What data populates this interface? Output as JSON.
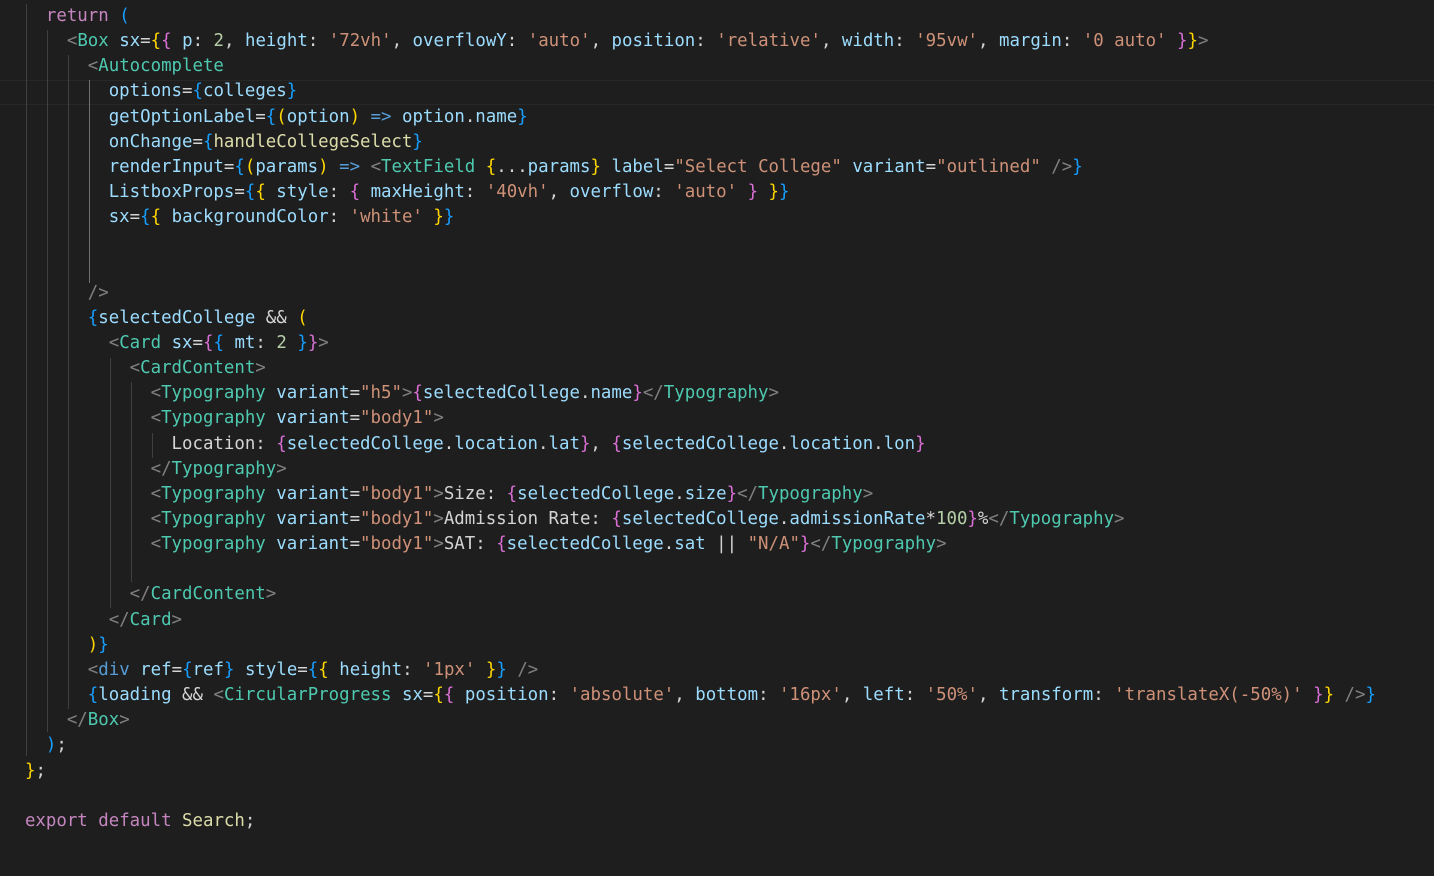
{
  "editor": {
    "language": "javascript-react",
    "theme": "dark",
    "lines": [
      [
        [
          "    ",
          "txt"
        ],
        [
          "return",
          "kw"
        ],
        [
          " ",
          "txt"
        ],
        [
          "(",
          "b3"
        ]
      ],
      [
        [
          "      ",
          "txt"
        ],
        [
          "<",
          "tb"
        ],
        [
          "Box",
          "tag"
        ],
        [
          " ",
          "txt"
        ],
        [
          "sx",
          "attr"
        ],
        [
          "=",
          "txt"
        ],
        [
          "{",
          "b1"
        ],
        [
          "{",
          "b2"
        ],
        [
          " ",
          "txt"
        ],
        [
          "p",
          "attr"
        ],
        [
          ": ",
          "txt"
        ],
        [
          "2",
          "num"
        ],
        [
          ", ",
          "txt"
        ],
        [
          "height",
          "attr"
        ],
        [
          ": ",
          "txt"
        ],
        [
          "'72vh'",
          "str"
        ],
        [
          ", ",
          "txt"
        ],
        [
          "overflowY",
          "attr"
        ],
        [
          ": ",
          "txt"
        ],
        [
          "'auto'",
          "str"
        ],
        [
          ", ",
          "txt"
        ],
        [
          "position",
          "attr"
        ],
        [
          ": ",
          "txt"
        ],
        [
          "'relative'",
          "str"
        ],
        [
          ", ",
          "txt"
        ],
        [
          "width",
          "attr"
        ],
        [
          ": ",
          "txt"
        ],
        [
          "'95vw'",
          "str"
        ],
        [
          ", ",
          "txt"
        ],
        [
          "margin",
          "attr"
        ],
        [
          ": ",
          "txt"
        ],
        [
          "'0 auto'",
          "str"
        ],
        [
          " ",
          "txt"
        ],
        [
          "}",
          "b2"
        ],
        [
          "}",
          "b1"
        ],
        [
          ">",
          "tb"
        ]
      ],
      [
        [
          "        ",
          "txt"
        ],
        [
          "<",
          "tb"
        ],
        [
          "Autocomplete",
          "tag"
        ]
      ],
      [
        [
          "          ",
          "txt"
        ],
        [
          "options",
          "attr"
        ],
        [
          "=",
          "txt"
        ],
        [
          "{",
          "b3"
        ],
        [
          "colleges",
          "var"
        ],
        [
          "}",
          "b3"
        ]
      ],
      [
        [
          "          ",
          "txt"
        ],
        [
          "getOptionLabel",
          "attr"
        ],
        [
          "=",
          "txt"
        ],
        [
          "{",
          "b3"
        ],
        [
          "(",
          "b1"
        ],
        [
          "option",
          "var"
        ],
        [
          ")",
          "b1"
        ],
        [
          " ",
          "txt"
        ],
        [
          "=>",
          "kb"
        ],
        [
          " ",
          "txt"
        ],
        [
          "option",
          "var"
        ],
        [
          ".",
          "txt"
        ],
        [
          "name",
          "var"
        ],
        [
          "}",
          "b3"
        ]
      ],
      [
        [
          "          ",
          "txt"
        ],
        [
          "onChange",
          "attr"
        ],
        [
          "=",
          "txt"
        ],
        [
          "{",
          "b3"
        ],
        [
          "handleCollegeSelect",
          "fn"
        ],
        [
          "}",
          "b3"
        ]
      ],
      [
        [
          "          ",
          "txt"
        ],
        [
          "renderInput",
          "attr"
        ],
        [
          "=",
          "txt"
        ],
        [
          "{",
          "b3"
        ],
        [
          "(",
          "b1"
        ],
        [
          "params",
          "var"
        ],
        [
          ")",
          "b1"
        ],
        [
          " ",
          "txt"
        ],
        [
          "=>",
          "kb"
        ],
        [
          " ",
          "txt"
        ],
        [
          "<",
          "tb"
        ],
        [
          "TextField",
          "tag"
        ],
        [
          " ",
          "txt"
        ],
        [
          "{",
          "b1"
        ],
        [
          "...",
          "txt"
        ],
        [
          "params",
          "var"
        ],
        [
          "}",
          "b1"
        ],
        [
          " ",
          "txt"
        ],
        [
          "label",
          "attr"
        ],
        [
          "=",
          "txt"
        ],
        [
          "\"Select College\"",
          "str"
        ],
        [
          " ",
          "txt"
        ],
        [
          "variant",
          "attr"
        ],
        [
          "=",
          "txt"
        ],
        [
          "\"outlined\"",
          "str"
        ],
        [
          " ",
          "txt"
        ],
        [
          "/>",
          "tb"
        ],
        [
          "}",
          "b3"
        ]
      ],
      [
        [
          "          ",
          "txt"
        ],
        [
          "ListboxProps",
          "attr"
        ],
        [
          "=",
          "txt"
        ],
        [
          "{",
          "b3"
        ],
        [
          "{",
          "b1"
        ],
        [
          " ",
          "txt"
        ],
        [
          "style",
          "attr"
        ],
        [
          ": ",
          "txt"
        ],
        [
          "{",
          "b2"
        ],
        [
          " ",
          "txt"
        ],
        [
          "maxHeight",
          "attr"
        ],
        [
          ": ",
          "txt"
        ],
        [
          "'40vh'",
          "str"
        ],
        [
          ", ",
          "txt"
        ],
        [
          "overflow",
          "attr"
        ],
        [
          ": ",
          "txt"
        ],
        [
          "'auto'",
          "str"
        ],
        [
          " ",
          "txt"
        ],
        [
          "}",
          "b2"
        ],
        [
          " ",
          "txt"
        ],
        [
          "}",
          "b1"
        ],
        [
          "}",
          "b3"
        ]
      ],
      [
        [
          "          ",
          "txt"
        ],
        [
          "sx",
          "attr"
        ],
        [
          "=",
          "txt"
        ],
        [
          "{",
          "b3"
        ],
        [
          "{",
          "b1"
        ],
        [
          " ",
          "txt"
        ],
        [
          "backgroundColor",
          "attr"
        ],
        [
          ": ",
          "txt"
        ],
        [
          "'white'",
          "str"
        ],
        [
          " ",
          "txt"
        ],
        [
          "}",
          "b1"
        ],
        [
          "}",
          "b3"
        ]
      ],
      [],
      [],
      [
        [
          "        ",
          "txt"
        ],
        [
          "/>",
          "tb"
        ]
      ],
      [
        [
          "        ",
          "txt"
        ],
        [
          "{",
          "b3"
        ],
        [
          "selectedCollege",
          "var"
        ],
        [
          " ",
          "txt"
        ],
        [
          "&&",
          "txt"
        ],
        [
          " ",
          "txt"
        ],
        [
          "(",
          "b1"
        ]
      ],
      [
        [
          "          ",
          "txt"
        ],
        [
          "<",
          "tb"
        ],
        [
          "Card",
          "tag"
        ],
        [
          " ",
          "txt"
        ],
        [
          "sx",
          "attr"
        ],
        [
          "=",
          "txt"
        ],
        [
          "{",
          "b2"
        ],
        [
          "{",
          "b3"
        ],
        [
          " ",
          "txt"
        ],
        [
          "mt",
          "attr"
        ],
        [
          ": ",
          "txt"
        ],
        [
          "2",
          "num"
        ],
        [
          " ",
          "txt"
        ],
        [
          "}",
          "b3"
        ],
        [
          "}",
          "b2"
        ],
        [
          ">",
          "tb"
        ]
      ],
      [
        [
          "            ",
          "txt"
        ],
        [
          "<",
          "tb"
        ],
        [
          "CardContent",
          "tag"
        ],
        [
          ">",
          "tb"
        ]
      ],
      [
        [
          "              ",
          "txt"
        ],
        [
          "<",
          "tb"
        ],
        [
          "Typography",
          "tag"
        ],
        [
          " ",
          "txt"
        ],
        [
          "variant",
          "attr"
        ],
        [
          "=",
          "txt"
        ],
        [
          "\"h5\"",
          "str"
        ],
        [
          ">",
          "tb"
        ],
        [
          "{",
          "b2"
        ],
        [
          "selectedCollege",
          "var"
        ],
        [
          ".",
          "txt"
        ],
        [
          "name",
          "var"
        ],
        [
          "}",
          "b2"
        ],
        [
          "</",
          "tb"
        ],
        [
          "Typography",
          "tag"
        ],
        [
          ">",
          "tb"
        ]
      ],
      [
        [
          "              ",
          "txt"
        ],
        [
          "<",
          "tb"
        ],
        [
          "Typography",
          "tag"
        ],
        [
          " ",
          "txt"
        ],
        [
          "variant",
          "attr"
        ],
        [
          "=",
          "txt"
        ],
        [
          "\"body1\"",
          "str"
        ],
        [
          ">",
          "tb"
        ]
      ],
      [
        [
          "                ",
          "txt"
        ],
        [
          "Location: ",
          "txt"
        ],
        [
          "{",
          "b2"
        ],
        [
          "selectedCollege",
          "var"
        ],
        [
          ".",
          "txt"
        ],
        [
          "location",
          "var"
        ],
        [
          ".",
          "txt"
        ],
        [
          "lat",
          "var"
        ],
        [
          "}",
          "b2"
        ],
        [
          ", ",
          "txt"
        ],
        [
          "{",
          "b2"
        ],
        [
          "selectedCollege",
          "var"
        ],
        [
          ".",
          "txt"
        ],
        [
          "location",
          "var"
        ],
        [
          ".",
          "txt"
        ],
        [
          "lon",
          "var"
        ],
        [
          "}",
          "b2"
        ]
      ],
      [
        [
          "              ",
          "txt"
        ],
        [
          "</",
          "tb"
        ],
        [
          "Typography",
          "tag"
        ],
        [
          ">",
          "tb"
        ]
      ],
      [
        [
          "              ",
          "txt"
        ],
        [
          "<",
          "tb"
        ],
        [
          "Typography",
          "tag"
        ],
        [
          " ",
          "txt"
        ],
        [
          "variant",
          "attr"
        ],
        [
          "=",
          "txt"
        ],
        [
          "\"body1\"",
          "str"
        ],
        [
          ">",
          "tb"
        ],
        [
          "Size: ",
          "txt"
        ],
        [
          "{",
          "b2"
        ],
        [
          "selectedCollege",
          "var"
        ],
        [
          ".",
          "txt"
        ],
        [
          "size",
          "var"
        ],
        [
          "}",
          "b2"
        ],
        [
          "</",
          "tb"
        ],
        [
          "Typography",
          "tag"
        ],
        [
          ">",
          "tb"
        ]
      ],
      [
        [
          "              ",
          "txt"
        ],
        [
          "<",
          "tb"
        ],
        [
          "Typography",
          "tag"
        ],
        [
          " ",
          "txt"
        ],
        [
          "variant",
          "attr"
        ],
        [
          "=",
          "txt"
        ],
        [
          "\"body1\"",
          "str"
        ],
        [
          ">",
          "tb"
        ],
        [
          "Admission Rate: ",
          "txt"
        ],
        [
          "{",
          "b2"
        ],
        [
          "selectedCollege",
          "var"
        ],
        [
          ".",
          "txt"
        ],
        [
          "admissionRate",
          "var"
        ],
        [
          "*",
          "txt"
        ],
        [
          "100",
          "num"
        ],
        [
          "}",
          "b2"
        ],
        [
          "%",
          "txt"
        ],
        [
          "</",
          "tb"
        ],
        [
          "Typography",
          "tag"
        ],
        [
          ">",
          "tb"
        ]
      ],
      [
        [
          "              ",
          "txt"
        ],
        [
          "<",
          "tb"
        ],
        [
          "Typography",
          "tag"
        ],
        [
          " ",
          "txt"
        ],
        [
          "variant",
          "attr"
        ],
        [
          "=",
          "txt"
        ],
        [
          "\"body1\"",
          "str"
        ],
        [
          ">",
          "tb"
        ],
        [
          "SAT: ",
          "txt"
        ],
        [
          "{",
          "b2"
        ],
        [
          "selectedCollege",
          "var"
        ],
        [
          ".",
          "txt"
        ],
        [
          "sat",
          "var"
        ],
        [
          " ",
          "txt"
        ],
        [
          "||",
          "txt"
        ],
        [
          " ",
          "txt"
        ],
        [
          "\"N/A\"",
          "str"
        ],
        [
          "}",
          "b2"
        ],
        [
          "</",
          "tb"
        ],
        [
          "Typography",
          "tag"
        ],
        [
          ">",
          "tb"
        ]
      ],
      [],
      [
        [
          "            ",
          "txt"
        ],
        [
          "</",
          "tb"
        ],
        [
          "CardContent",
          "tag"
        ],
        [
          ">",
          "tb"
        ]
      ],
      [
        [
          "          ",
          "txt"
        ],
        [
          "</",
          "tb"
        ],
        [
          "Card",
          "tag"
        ],
        [
          ">",
          "tb"
        ]
      ],
      [
        [
          "        ",
          "txt"
        ],
        [
          ")",
          "b1"
        ],
        [
          "}",
          "b3"
        ]
      ],
      [
        [
          "        ",
          "txt"
        ],
        [
          "<",
          "tb"
        ],
        [
          "div",
          "kb"
        ],
        [
          " ",
          "txt"
        ],
        [
          "ref",
          "attr"
        ],
        [
          "=",
          "txt"
        ],
        [
          "{",
          "b3"
        ],
        [
          "ref",
          "var"
        ],
        [
          "}",
          "b3"
        ],
        [
          " ",
          "txt"
        ],
        [
          "style",
          "attr"
        ],
        [
          "=",
          "txt"
        ],
        [
          "{",
          "b3"
        ],
        [
          "{",
          "b1"
        ],
        [
          " ",
          "txt"
        ],
        [
          "height",
          "attr"
        ],
        [
          ": ",
          "txt"
        ],
        [
          "'1px'",
          "str"
        ],
        [
          " ",
          "txt"
        ],
        [
          "}",
          "b1"
        ],
        [
          "}",
          "b3"
        ],
        [
          " ",
          "txt"
        ],
        [
          "/>",
          "tb"
        ]
      ],
      [
        [
          "        ",
          "txt"
        ],
        [
          "{",
          "b3"
        ],
        [
          "loading",
          "var"
        ],
        [
          " ",
          "txt"
        ],
        [
          "&&",
          "txt"
        ],
        [
          " ",
          "txt"
        ],
        [
          "<",
          "tb"
        ],
        [
          "CircularProgress",
          "tag"
        ],
        [
          " ",
          "txt"
        ],
        [
          "sx",
          "attr"
        ],
        [
          "=",
          "txt"
        ],
        [
          "{",
          "b1"
        ],
        [
          "{",
          "b2"
        ],
        [
          " ",
          "txt"
        ],
        [
          "position",
          "attr"
        ],
        [
          ": ",
          "txt"
        ],
        [
          "'absolute'",
          "str"
        ],
        [
          ", ",
          "txt"
        ],
        [
          "bottom",
          "attr"
        ],
        [
          ": ",
          "txt"
        ],
        [
          "'16px'",
          "str"
        ],
        [
          ", ",
          "txt"
        ],
        [
          "left",
          "attr"
        ],
        [
          ": ",
          "txt"
        ],
        [
          "'50%'",
          "str"
        ],
        [
          ", ",
          "txt"
        ],
        [
          "transform",
          "attr"
        ],
        [
          ": ",
          "txt"
        ],
        [
          "'translateX(-50%)'",
          "str"
        ],
        [
          " ",
          "txt"
        ],
        [
          "}",
          "b2"
        ],
        [
          "}",
          "b1"
        ],
        [
          " ",
          "txt"
        ],
        [
          "/>",
          "tb"
        ],
        [
          "}",
          "b3"
        ]
      ],
      [
        [
          "      ",
          "txt"
        ],
        [
          "</",
          "tb"
        ],
        [
          "Box",
          "tag"
        ],
        [
          ">",
          "tb"
        ]
      ],
      [
        [
          "    ",
          "txt"
        ],
        [
          ")",
          "b3"
        ],
        [
          ";",
          "txt"
        ]
      ],
      [
        [
          "  ",
          "txt"
        ],
        [
          "}",
          "b1"
        ],
        [
          ";",
          "txt"
        ]
      ],
      [],
      [
        [
          "  ",
          "txt"
        ],
        [
          "export",
          "kw"
        ],
        [
          " ",
          "txt"
        ],
        [
          "default",
          "kw"
        ],
        [
          " ",
          "txt"
        ],
        [
          "Search",
          "fn"
        ],
        [
          ";",
          "txt"
        ]
      ]
    ]
  }
}
